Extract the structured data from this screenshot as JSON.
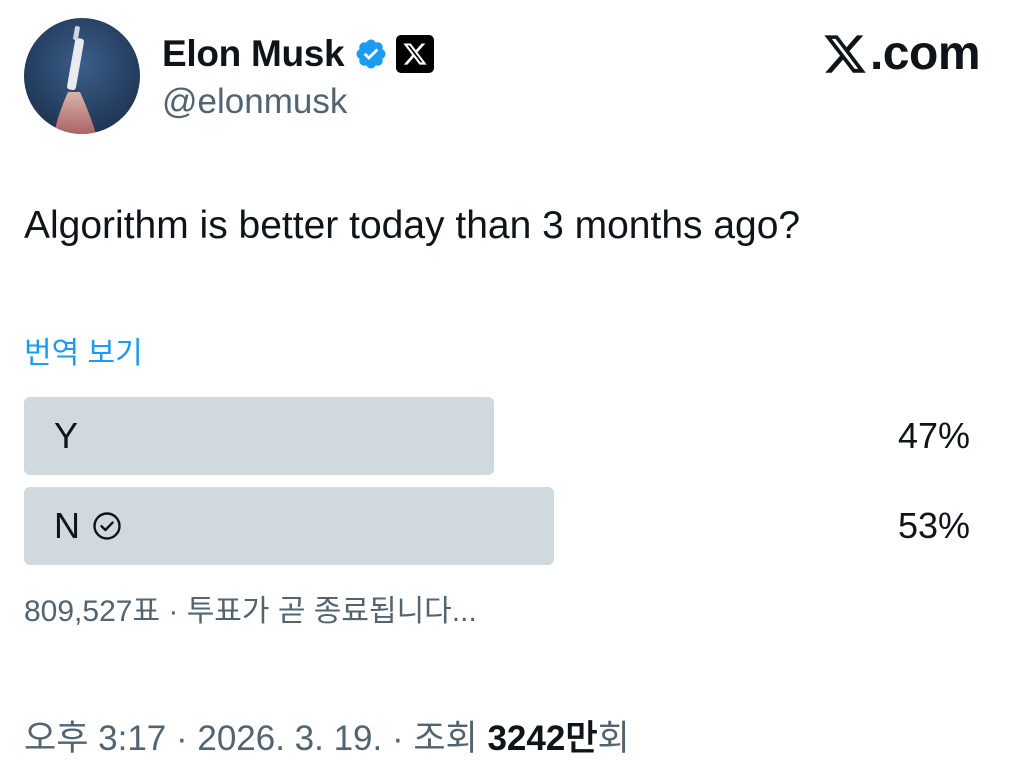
{
  "author": {
    "display_name": "Elon Musk",
    "handle": "@elonmusk",
    "verified_icon": "verified-badge-icon",
    "affiliate_icon": "x-logo-icon"
  },
  "brand": {
    "text": ".com",
    "icon": "x-logo-icon"
  },
  "tweet": {
    "text": "Algorithm is better today than 3 months ago?",
    "translate_label": "번역 보기"
  },
  "poll": {
    "options": [
      {
        "label": "Y",
        "percent_text": "47%",
        "fraction": 0.47,
        "winner": false
      },
      {
        "label": "N",
        "percent_text": "53%",
        "fraction": 0.53,
        "winner": true
      }
    ],
    "meta": "809,527표 · 투표가 곧 종료됩니다..."
  },
  "footer": {
    "timestamp": "오후 3:17 · 2026. 3. 19. · 조회 ",
    "views_number": "3242만",
    "views_suffix": "회"
  },
  "colors": {
    "accent": "#1d9bf0",
    "poll_bar": "#cfd9de",
    "secondary_text": "#536471",
    "primary_text": "#0f1419"
  }
}
